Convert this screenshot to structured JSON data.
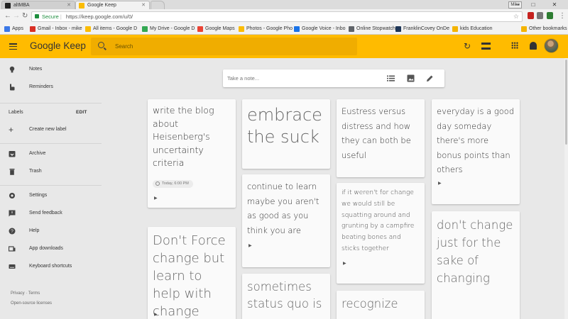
{
  "browser": {
    "tabs": [
      {
        "title": "altMBA",
        "active": false
      },
      {
        "title": "Google Keep",
        "active": true
      }
    ],
    "profile_badge": "Mike",
    "omnibox": {
      "secure_label": "Secure",
      "url": "https://keep.google.com/u/0/"
    },
    "bookmarks": [
      {
        "label": "Apps",
        "color": "#3b78e7"
      },
      {
        "label": "Gmail - Inbox - mike",
        "color": "#d93025"
      },
      {
        "label": "All items - Google D",
        "color": "#fbbc04"
      },
      {
        "label": "My Drive - Google D",
        "color": "#34a853"
      },
      {
        "label": "Google Maps",
        "color": "#ea4335"
      },
      {
        "label": "Photos - Google Pho",
        "color": "#fbbc04"
      },
      {
        "label": "Google Voice - Inbo",
        "color": "#1a73e8"
      },
      {
        "label": "Online Stopwatch",
        "color": "#5f6368"
      },
      {
        "label": "FranklinCovey OnDe",
        "color": "#1d3557"
      },
      {
        "label": "kids Education",
        "color": "#f4b400"
      },
      {
        "label": "Other bookmarks",
        "color": "#f4b400"
      }
    ]
  },
  "header": {
    "brand_google": "Google",
    "brand_keep": "Keep",
    "search_placeholder": "Search",
    "accent": "#ffbb00"
  },
  "sidebar": {
    "items": [
      {
        "label": "Notes",
        "icon": "lightbulb-icon"
      },
      {
        "label": "Reminders",
        "icon": "reminder-hand-icon"
      }
    ],
    "labels_heading": "Labels",
    "edit_label": "EDIT",
    "create_label": "Create new label",
    "archive": "Archive",
    "trash": "Trash",
    "settings": "Settings",
    "send_feedback": "Send feedback",
    "help": "Help",
    "app_downloads": "App downloads",
    "keyboard_shortcuts": "Keyboard shortcuts",
    "footer_privacy": "Privacy",
    "footer_terms": "Terms",
    "footer_sep": "·",
    "footer_licenses": "Open-source licenses"
  },
  "take_note": {
    "placeholder": "Take a note..."
  },
  "notes": [
    {
      "text": "write the blog about Heisenberg's uncertainty criteria",
      "reminder": "Today, 6:00 PM"
    },
    {
      "text": "embrace the suck"
    },
    {
      "text": "Eustress versus distress and how they can both be useful"
    },
    {
      "text": "everyday is a good day someday there's more bonus points than others"
    },
    {
      "text": "Don't Force change but learn to help with change"
    },
    {
      "text": "continue to learn maybe you aren't as good as you think you are"
    },
    {
      "text": "if it weren't for change we would still be squatting around and grunting by a campfire beating bones and sticks together"
    },
    {
      "text": "don't change just for the sake of changing"
    },
    {
      "text": "sometimes status quo is"
    },
    {
      "text": "recognize"
    }
  ]
}
